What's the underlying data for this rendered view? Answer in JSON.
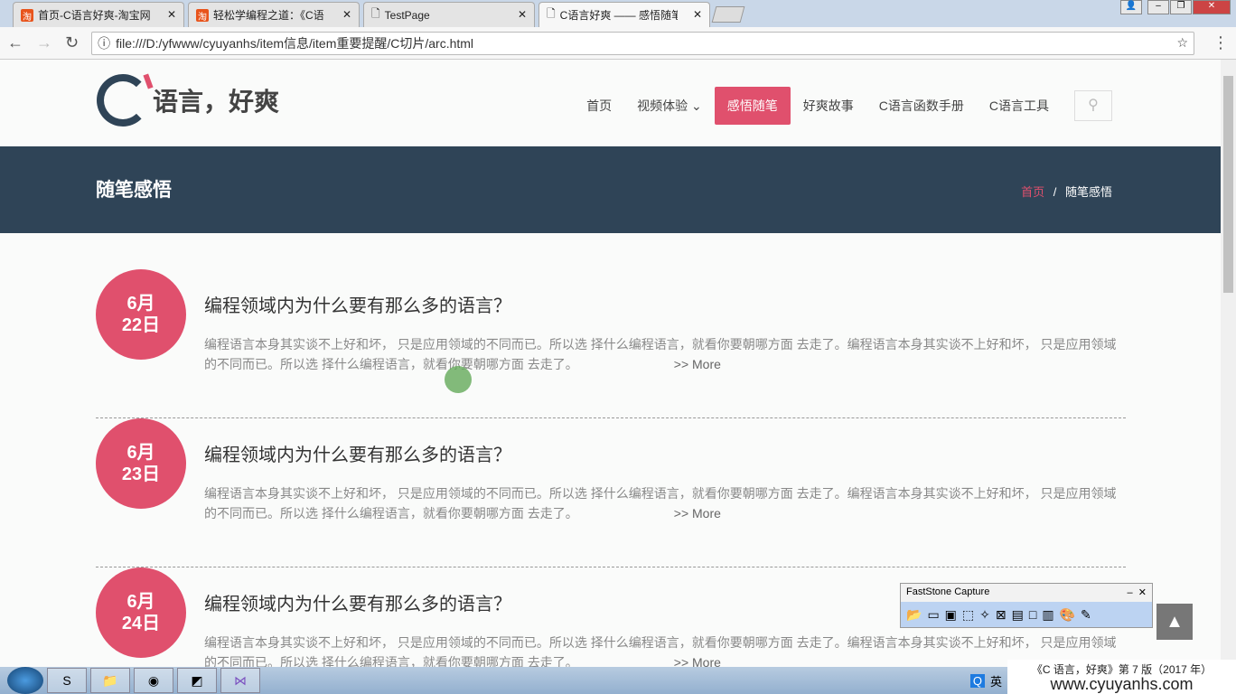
{
  "browser": {
    "tabs": [
      {
        "label": "首页-C语言好爽-淘宝网",
        "icon": "taobao-icon"
      },
      {
        "label": "轻松学编程之道：《C语",
        "icon": "taobao-icon"
      },
      {
        "label": "TestPage",
        "icon": "page-icon"
      },
      {
        "label": "C语言好爽 —— 感悟随笔",
        "icon": "page-icon",
        "active": true
      }
    ],
    "url": "file:///D:/yfwww/cyuyanhs/item信息/item重要提醒/C切片/arc.html"
  },
  "site": {
    "logo_text": "语言，好爽",
    "logo_letter": "C",
    "nav": [
      {
        "label": "首页"
      },
      {
        "label": "视频体验 ⌄"
      },
      {
        "label": "感悟随笔",
        "active": true
      },
      {
        "label": "好爽故事"
      },
      {
        "label": "C语言函数手册"
      },
      {
        "label": "C语言工具"
      }
    ],
    "accent": "#e0506d",
    "banner_color": "#2f4457"
  },
  "banner": {
    "title": "随笔感悟",
    "crumb_home": "首页",
    "crumb_sep": "/",
    "crumb_current": "随笔感悟"
  },
  "posts": [
    {
      "month": "6月",
      "day": "22日",
      "title": "编程领域内为什么要有那么多的语言？",
      "body": "编程语言本身其实谈不上好和坏， 只是应用领域的不同而已。所以选 择什么编程语言，就看你要朝哪方面 去走了。编程语言本身其实谈不上好和坏， 只是应用领域的不同而已。所以选 择什么编程语言，就看你要朝哪方面 去走了。",
      "more": ">> More"
    },
    {
      "month": "6月",
      "day": "23日",
      "title": "编程领域内为什么要有那么多的语言？",
      "body": "编程语言本身其实谈不上好和坏， 只是应用领域的不同而已。所以选 择什么编程语言，就看你要朝哪方面 去走了。编程语言本身其实谈不上好和坏， 只是应用领域的不同而已。所以选 择什么编程语言，就看你要朝哪方面 去走了。",
      "more": ">> More"
    },
    {
      "month": "6月",
      "day": "24日",
      "title": "编程领域内为什么要有那么多的语言？",
      "body": "编程语言本身其实谈不上好和坏， 只是应用领域的不同而已。所以选 择什么编程语言，就看你要朝哪方面 去走了。编程语言本身其实谈不上好和坏， 只是应用领域的不同而已。所以选 择什么编程语言，就看你要朝哪方面 去走了。",
      "more": ">> More"
    }
  ],
  "faststone": {
    "title": "FastStone Capture"
  },
  "tray": {
    "ime": "英"
  },
  "watermark": {
    "line1": "《C 语言，好爽》第 7 版（2017 年）",
    "line2": "www.cyuyanhs.com"
  }
}
